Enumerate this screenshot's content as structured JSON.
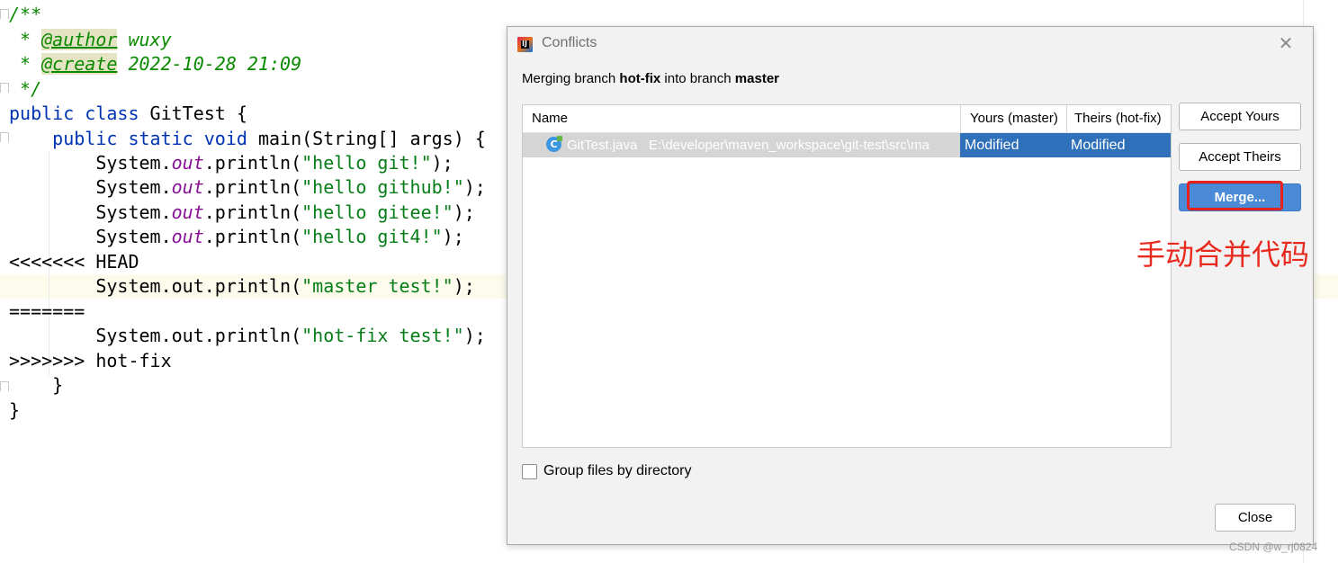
{
  "editor": {
    "lines": [
      "/**",
      " * @author wuxy",
      " * @create 2022-10-28 21:09",
      " */",
      "public class GitTest {",
      "    public static void main(String[] args) {",
      "        System.out.println(\"hello git!\");",
      "        System.out.println(\"hello github!\");",
      "        System.out.println(\"hello gitee!\");",
      "        System.out.println(\"hello git4!\");",
      "<<<<<<< HEAD",
      "        System.out.println(\"master test!\");",
      "=======",
      "        System.out.println(\"hot-fix test!\");",
      ">>>>>>> hot-fix",
      "    }",
      "}"
    ]
  },
  "dialog": {
    "title": "Conflicts",
    "app_icon_letter": "IJ",
    "close_glyph": "✕",
    "merging_prefix": "Merging branch ",
    "source_branch": "hot-fix",
    "merging_mid": " into branch ",
    "target_branch": "master",
    "columns": {
      "name": "Name",
      "yours": "Yours (master)",
      "theirs": "Theirs (hot-fix)"
    },
    "files": [
      {
        "name": "GitTest.java",
        "path": "E:\\developer\\maven_workspace\\git-test\\src\\ma",
        "yours": "Modified",
        "theirs": "Modified"
      }
    ],
    "buttons": {
      "accept_yours": "Accept Yours",
      "accept_theirs": "Accept Theirs",
      "merge": "Merge...",
      "close": "Close"
    },
    "group_by_directory_label": "Group files by directory",
    "group_by_directory_checked": false
  },
  "annotation": {
    "text": "手动合并代码",
    "color": "#e8201b"
  },
  "watermark": "CSDN @w_rj0824",
  "colors": {
    "selection_blue": "#2e70b9",
    "primary_button": "#4a8ad6",
    "comment_green": "#0a8a00",
    "keyword_blue": "#0033b3",
    "string_green": "#067d17",
    "field_purple": "#871094"
  }
}
